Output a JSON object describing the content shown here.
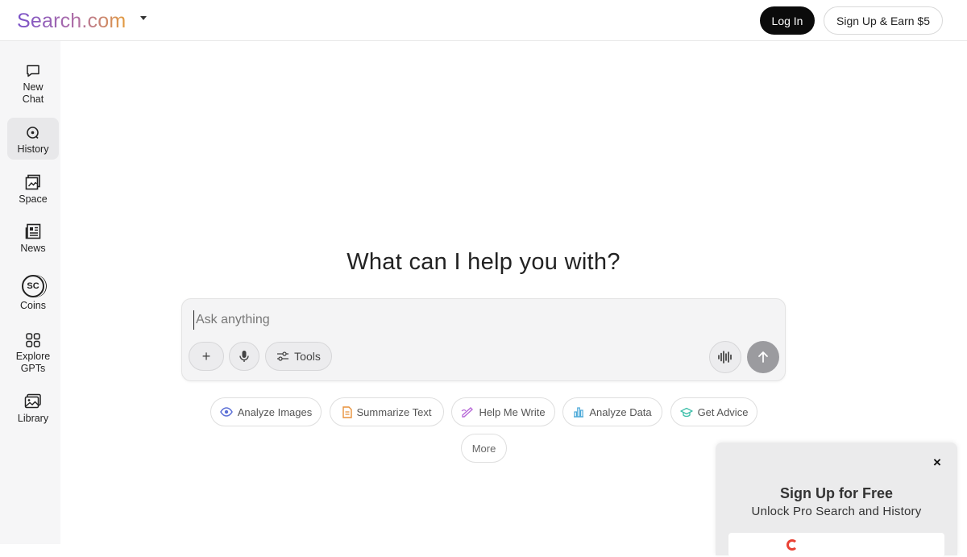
{
  "header": {
    "logo": "Search.com",
    "login_label": "Log In",
    "signup_label": "Sign Up & Earn $5"
  },
  "sidebar": {
    "items": [
      {
        "label": "New\nChat",
        "icon": "chat-bubble-icon"
      },
      {
        "label": "History",
        "icon": "history-icon"
      },
      {
        "label": "Space",
        "icon": "space-icon"
      },
      {
        "label": "News",
        "icon": "news-icon"
      },
      {
        "label": "Coins",
        "icon": "coins-icon",
        "icon_text": "SC"
      },
      {
        "label": "Explore\nGPTs",
        "icon": "grid-icon"
      },
      {
        "label": "Library",
        "icon": "image-library-icon"
      }
    ]
  },
  "main": {
    "headline": "What can I help you with?",
    "input_placeholder": "Ask anything",
    "plus_label": "+",
    "tools_label": "Tools",
    "chips": [
      {
        "label": "Analyze Images",
        "icon": "eye-icon",
        "color": "#5b6fd6"
      },
      {
        "label": "Summarize Text",
        "icon": "document-icon",
        "color": "#e8913a"
      },
      {
        "label": "Help Me Write",
        "icon": "pen-icon",
        "color": "#b86ad8"
      },
      {
        "label": "Analyze Data",
        "icon": "bar-chart-icon",
        "color": "#4aa8d8"
      },
      {
        "label": "Get Advice",
        "icon": "graduation-cap-icon",
        "color": "#3fbfaa"
      }
    ],
    "more_label": "More"
  },
  "promo": {
    "close": "×",
    "title": "Sign Up for Free",
    "subtitle": "Unlock Pro Search and History"
  }
}
